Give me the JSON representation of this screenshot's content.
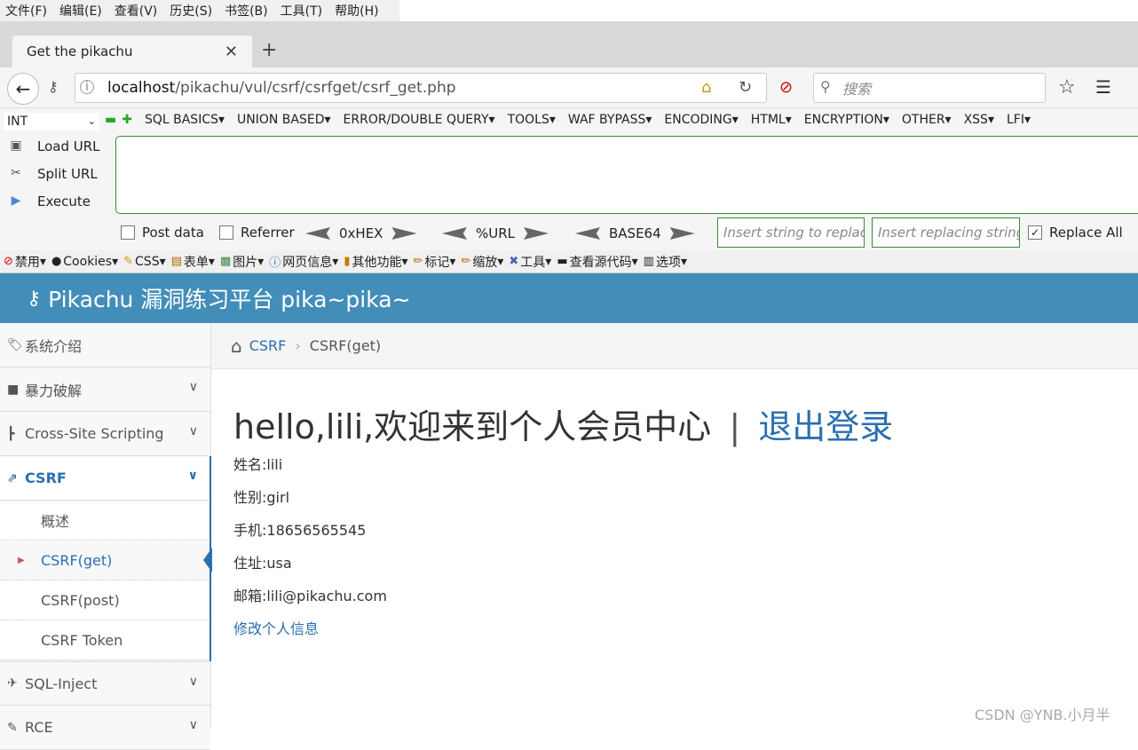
{
  "browser": {
    "menu": [
      "文件(F)",
      "编辑(E)",
      "查看(V)",
      "历史(S)",
      "书签(B)",
      "工具(T)",
      "帮助(H)"
    ],
    "tab_title": "Get the pikachu",
    "url_host": "localhost",
    "url_path": "/pikachu/vul/csrf/csrfget/csrf_get.php",
    "search_placeholder": "搜索"
  },
  "hackbar": {
    "encoding": "INT",
    "menu": [
      "SQL BASICS",
      "UNION BASED",
      "ERROR/DOUBLE QUERY",
      "TOOLS",
      "WAF BYPASS",
      "ENCODING",
      "HTML",
      "ENCRYPTION",
      "OTHER",
      "XSS",
      "LFI"
    ],
    "load_url": "Load URL",
    "split_url": "Split URL",
    "execute": "Execute",
    "post_data": "Post data",
    "referrer": "Referrer",
    "hex": "0xHEX",
    "urlenc": "%URL",
    "base64": "BASE64",
    "replace_placeholder": "Insert string to replace",
    "replacing_placeholder": "Insert replacing string",
    "replace_all": "Replace All"
  },
  "webdev": [
    "禁用",
    "Cookies",
    "CSS",
    "表单",
    "图片",
    "网页信息",
    "其他功能",
    "标记",
    "缩放",
    "工具",
    "查看源代码",
    "选项"
  ],
  "site": {
    "title": "Pikachu 漏洞练习平台 pika~pika~",
    "sidebar": {
      "intro": "系统介绍",
      "brute": "暴力破解",
      "xss": "Cross-Site Scripting",
      "csrf": "CSRF",
      "sub": [
        "概述",
        "CSRF(get)",
        "CSRF(post)",
        "CSRF Token"
      ],
      "sqli": "SQL-Inject",
      "rce": "RCE"
    },
    "breadcrumb": {
      "parent": "CSRF",
      "current": "CSRF(get)"
    },
    "welcome": "hello,lili,欢迎来到个人会员中心",
    "sep": "|",
    "logout": "退出登录",
    "name": "姓名:lili",
    "sex": "性别:girl",
    "phone": "手机:18656565545",
    "address": "住址:usa",
    "email": "邮箱:lili@pikachu.com",
    "edit": "修改个人信息"
  },
  "watermark": "CSDN @YNB.小月半",
  "colors": {
    "header": "#438eb9",
    "link": "#2a6fb0",
    "csrf_active": "#2a6fb0"
  }
}
